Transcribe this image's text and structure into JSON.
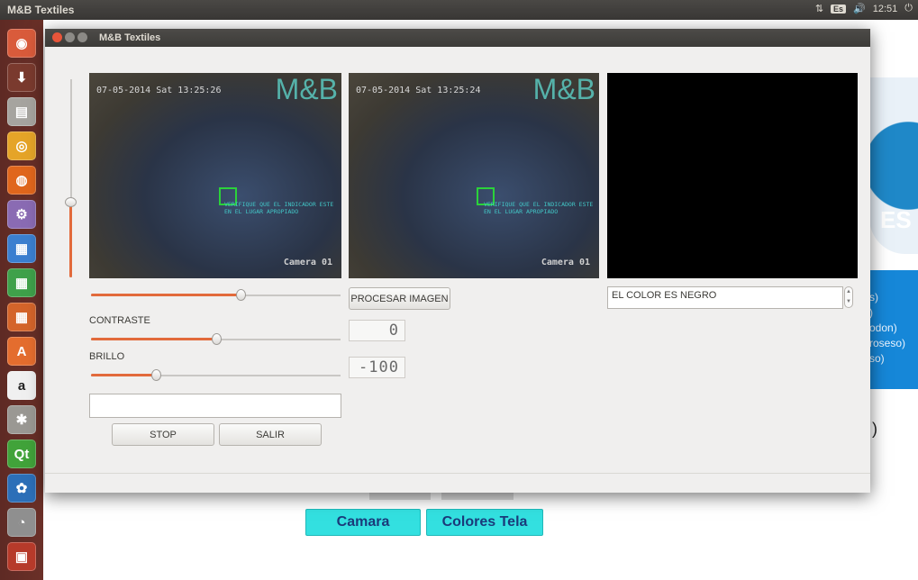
{
  "topbar": {
    "title": "M&B Textiles",
    "kbd": "Es",
    "volume_icon": "volume-icon",
    "clock": "12:51"
  },
  "window": {
    "title": "M&B Textiles"
  },
  "cameras": [
    {
      "timestamp": "07-05-2014 Sat 13:25:26",
      "logo": "M&B",
      "label": "Camera 01",
      "overlay": "VERIFIQUE QUE EL INDICADOR ESTE EN EL LUGAR APROPIADO"
    },
    {
      "timestamp": "07-05-2014 Sat 13:25:24",
      "logo": "M&B",
      "label": "Camera 01",
      "overlay": "VERIFIQUE QUE EL INDICADOR ESTE EN EL LUGAR APROPIADO"
    }
  ],
  "controls": {
    "slider_top_value": 0.6,
    "contraste_label": "CONTRASTE",
    "contraste_value": 0.5,
    "brillo_label": "BRILLO",
    "brillo_value": 0.26,
    "vertical_value": 0.38,
    "text_value": "",
    "stop_label": "STOP",
    "salir_label": "SALIR"
  },
  "process": {
    "button_label": "PROCESAR IMAGEN",
    "lcd1": "0",
    "lcd2": "-100"
  },
  "result": {
    "color_text": "EL COLOR ES NEGRO"
  },
  "background_app": {
    "buttons": [
      "Camara",
      "Colores Tela"
    ],
    "blue_panel_lines": [
      "s)",
      ")",
      "odon)",
      "roseso)",
      "",
      "so)"
    ],
    "logo_text": "ES",
    "paren": ")"
  }
}
